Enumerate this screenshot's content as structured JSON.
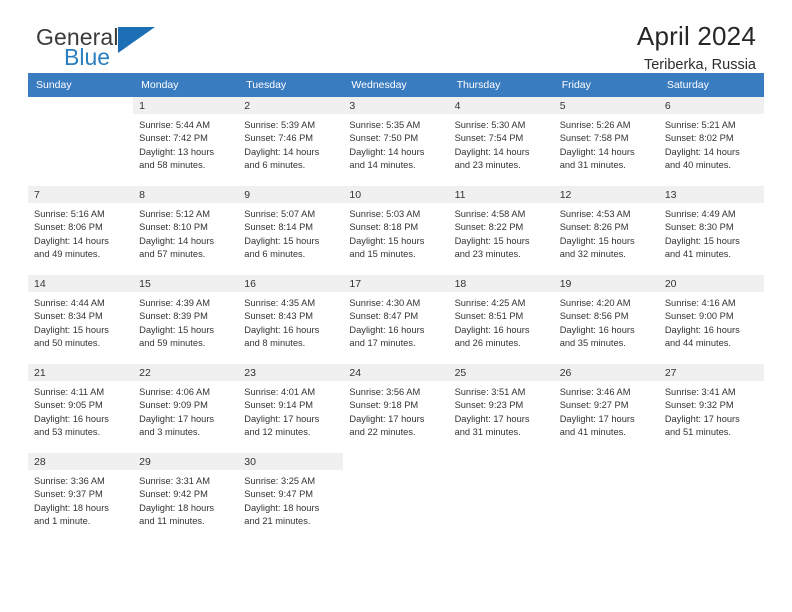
{
  "brand": {
    "line1": "General",
    "line2": "Blue",
    "triangle_icon": "triangle-logo-icon",
    "accent_color": "#1c6fb5",
    "text_color": "#2a7fc1"
  },
  "header": {
    "title": "April 2024",
    "subtitle": "Teriberka, Russia"
  },
  "calendar": {
    "header_bg": "#3a7cc0",
    "header_text_color": "#ffffff",
    "weekday_headers": [
      "Sunday",
      "Monday",
      "Tuesday",
      "Wednesday",
      "Thursday",
      "Friday",
      "Saturday"
    ],
    "weeks": [
      [
        {
          "day": "",
          "sunrise": "",
          "sunset": "",
          "daylight": "",
          "daylight2": ""
        },
        {
          "day": "1",
          "sunrise": "Sunrise: 5:44 AM",
          "sunset": "Sunset: 7:42 PM",
          "daylight": "Daylight: 13 hours",
          "daylight2": "and 58 minutes."
        },
        {
          "day": "2",
          "sunrise": "Sunrise: 5:39 AM",
          "sunset": "Sunset: 7:46 PM",
          "daylight": "Daylight: 14 hours",
          "daylight2": "and 6 minutes."
        },
        {
          "day": "3",
          "sunrise": "Sunrise: 5:35 AM",
          "sunset": "Sunset: 7:50 PM",
          "daylight": "Daylight: 14 hours",
          "daylight2": "and 14 minutes."
        },
        {
          "day": "4",
          "sunrise": "Sunrise: 5:30 AM",
          "sunset": "Sunset: 7:54 PM",
          "daylight": "Daylight: 14 hours",
          "daylight2": "and 23 minutes."
        },
        {
          "day": "5",
          "sunrise": "Sunrise: 5:26 AM",
          "sunset": "Sunset: 7:58 PM",
          "daylight": "Daylight: 14 hours",
          "daylight2": "and 31 minutes."
        },
        {
          "day": "6",
          "sunrise": "Sunrise: 5:21 AM",
          "sunset": "Sunset: 8:02 PM",
          "daylight": "Daylight: 14 hours",
          "daylight2": "and 40 minutes."
        }
      ],
      [
        {
          "day": "7",
          "sunrise": "Sunrise: 5:16 AM",
          "sunset": "Sunset: 8:06 PM",
          "daylight": "Daylight: 14 hours",
          "daylight2": "and 49 minutes."
        },
        {
          "day": "8",
          "sunrise": "Sunrise: 5:12 AM",
          "sunset": "Sunset: 8:10 PM",
          "daylight": "Daylight: 14 hours",
          "daylight2": "and 57 minutes."
        },
        {
          "day": "9",
          "sunrise": "Sunrise: 5:07 AM",
          "sunset": "Sunset: 8:14 PM",
          "daylight": "Daylight: 15 hours",
          "daylight2": "and 6 minutes."
        },
        {
          "day": "10",
          "sunrise": "Sunrise: 5:03 AM",
          "sunset": "Sunset: 8:18 PM",
          "daylight": "Daylight: 15 hours",
          "daylight2": "and 15 minutes."
        },
        {
          "day": "11",
          "sunrise": "Sunrise: 4:58 AM",
          "sunset": "Sunset: 8:22 PM",
          "daylight": "Daylight: 15 hours",
          "daylight2": "and 23 minutes."
        },
        {
          "day": "12",
          "sunrise": "Sunrise: 4:53 AM",
          "sunset": "Sunset: 8:26 PM",
          "daylight": "Daylight: 15 hours",
          "daylight2": "and 32 minutes."
        },
        {
          "day": "13",
          "sunrise": "Sunrise: 4:49 AM",
          "sunset": "Sunset: 8:30 PM",
          "daylight": "Daylight: 15 hours",
          "daylight2": "and 41 minutes."
        }
      ],
      [
        {
          "day": "14",
          "sunrise": "Sunrise: 4:44 AM",
          "sunset": "Sunset: 8:34 PM",
          "daylight": "Daylight: 15 hours",
          "daylight2": "and 50 minutes."
        },
        {
          "day": "15",
          "sunrise": "Sunrise: 4:39 AM",
          "sunset": "Sunset: 8:39 PM",
          "daylight": "Daylight: 15 hours",
          "daylight2": "and 59 minutes."
        },
        {
          "day": "16",
          "sunrise": "Sunrise: 4:35 AM",
          "sunset": "Sunset: 8:43 PM",
          "daylight": "Daylight: 16 hours",
          "daylight2": "and 8 minutes."
        },
        {
          "day": "17",
          "sunrise": "Sunrise: 4:30 AM",
          "sunset": "Sunset: 8:47 PM",
          "daylight": "Daylight: 16 hours",
          "daylight2": "and 17 minutes."
        },
        {
          "day": "18",
          "sunrise": "Sunrise: 4:25 AM",
          "sunset": "Sunset: 8:51 PM",
          "daylight": "Daylight: 16 hours",
          "daylight2": "and 26 minutes."
        },
        {
          "day": "19",
          "sunrise": "Sunrise: 4:20 AM",
          "sunset": "Sunset: 8:56 PM",
          "daylight": "Daylight: 16 hours",
          "daylight2": "and 35 minutes."
        },
        {
          "day": "20",
          "sunrise": "Sunrise: 4:16 AM",
          "sunset": "Sunset: 9:00 PM",
          "daylight": "Daylight: 16 hours",
          "daylight2": "and 44 minutes."
        }
      ],
      [
        {
          "day": "21",
          "sunrise": "Sunrise: 4:11 AM",
          "sunset": "Sunset: 9:05 PM",
          "daylight": "Daylight: 16 hours",
          "daylight2": "and 53 minutes."
        },
        {
          "day": "22",
          "sunrise": "Sunrise: 4:06 AM",
          "sunset": "Sunset: 9:09 PM",
          "daylight": "Daylight: 17 hours",
          "daylight2": "and 3 minutes."
        },
        {
          "day": "23",
          "sunrise": "Sunrise: 4:01 AM",
          "sunset": "Sunset: 9:14 PM",
          "daylight": "Daylight: 17 hours",
          "daylight2": "and 12 minutes."
        },
        {
          "day": "24",
          "sunrise": "Sunrise: 3:56 AM",
          "sunset": "Sunset: 9:18 PM",
          "daylight": "Daylight: 17 hours",
          "daylight2": "and 22 minutes."
        },
        {
          "day": "25",
          "sunrise": "Sunrise: 3:51 AM",
          "sunset": "Sunset: 9:23 PM",
          "daylight": "Daylight: 17 hours",
          "daylight2": "and 31 minutes."
        },
        {
          "day": "26",
          "sunrise": "Sunrise: 3:46 AM",
          "sunset": "Sunset: 9:27 PM",
          "daylight": "Daylight: 17 hours",
          "daylight2": "and 41 minutes."
        },
        {
          "day": "27",
          "sunrise": "Sunrise: 3:41 AM",
          "sunset": "Sunset: 9:32 PM",
          "daylight": "Daylight: 17 hours",
          "daylight2": "and 51 minutes."
        }
      ],
      [
        {
          "day": "28",
          "sunrise": "Sunrise: 3:36 AM",
          "sunset": "Sunset: 9:37 PM",
          "daylight": "Daylight: 18 hours",
          "daylight2": "and 1 minute."
        },
        {
          "day": "29",
          "sunrise": "Sunrise: 3:31 AM",
          "sunset": "Sunset: 9:42 PM",
          "daylight": "Daylight: 18 hours",
          "daylight2": "and 11 minutes."
        },
        {
          "day": "30",
          "sunrise": "Sunrise: 3:25 AM",
          "sunset": "Sunset: 9:47 PM",
          "daylight": "Daylight: 18 hours",
          "daylight2": "and 21 minutes."
        },
        {
          "day": "",
          "sunrise": "",
          "sunset": "",
          "daylight": "",
          "daylight2": ""
        },
        {
          "day": "",
          "sunrise": "",
          "sunset": "",
          "daylight": "",
          "daylight2": ""
        },
        {
          "day": "",
          "sunrise": "",
          "sunset": "",
          "daylight": "",
          "daylight2": ""
        },
        {
          "day": "",
          "sunrise": "",
          "sunset": "",
          "daylight": "",
          "daylight2": ""
        }
      ]
    ]
  }
}
